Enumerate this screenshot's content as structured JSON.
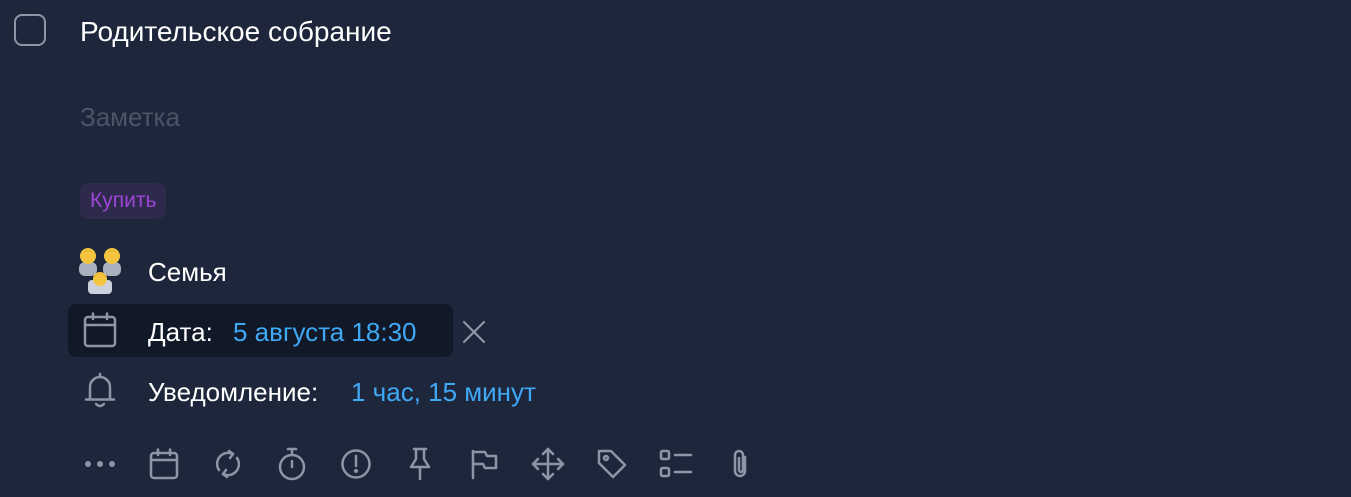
{
  "task": {
    "title": "Родительское собрание",
    "note_placeholder": "Заметка",
    "completed": false
  },
  "tag": {
    "label": "Купить",
    "color": "#9d45d8"
  },
  "list": {
    "icon": "family-emoji-icon",
    "name": "Семья"
  },
  "date": {
    "label": "Дата:",
    "value": "5 августа 18:30",
    "icon": "calendar-icon",
    "clear_icon": "close-icon"
  },
  "reminder": {
    "label": "Уведомление:",
    "value": "1 час, 15 минут",
    "icon": "bell-icon"
  },
  "toolbar": {
    "icons": [
      "more-icon",
      "calendar-icon",
      "repeat-icon",
      "timer-icon",
      "priority-icon",
      "pin-icon",
      "flag-icon",
      "move-icon",
      "tag-icon",
      "checklist-icon",
      "attachment-icon"
    ]
  },
  "colors": {
    "background": "#1e263b",
    "accent": "#3fa9f5",
    "highlight_bg": "#111828",
    "icon": "#8e95a6"
  }
}
